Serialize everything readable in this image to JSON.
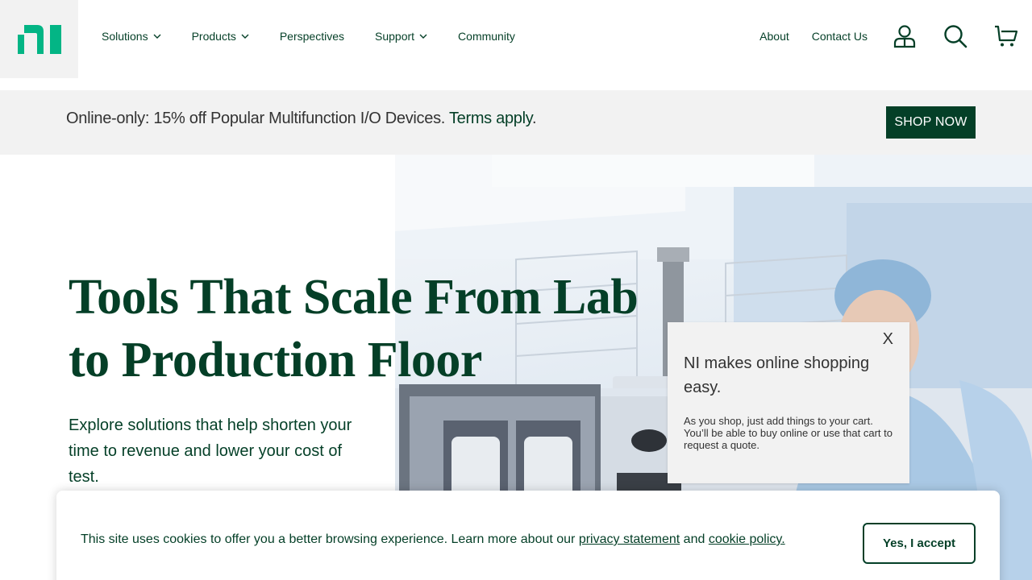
{
  "brand": {
    "logo_text": "ni",
    "accent": "#03b585",
    "dark_green": "#043f27"
  },
  "nav": {
    "items": [
      {
        "label": "Solutions",
        "has_dropdown": true
      },
      {
        "label": "Products",
        "has_dropdown": true
      },
      {
        "label": "Perspectives",
        "has_dropdown": false
      },
      {
        "label": "Support",
        "has_dropdown": true
      },
      {
        "label": "Community",
        "has_dropdown": false
      }
    ],
    "right_links": [
      {
        "label": "About"
      },
      {
        "label": "Contact Us"
      }
    ],
    "icons": [
      "user-icon",
      "search-icon",
      "cart-icon"
    ]
  },
  "promo": {
    "text": "Online-only: 15% off Popular Multifunction I/O Devices. ",
    "link_text": "Terms apply",
    "suffix": ".",
    "button_label": "SHOP NOW"
  },
  "hero": {
    "title": "Tools That Scale From Lab to Production Floor",
    "subtitle": "Explore solutions that help shorten your time to revenue and lower your cost of test."
  },
  "popup": {
    "close_label": "X",
    "title": "NI makes online shopping easy.",
    "body": "As you shop, just add things to your cart. You’ll be able to buy online or use that cart to request a quote."
  },
  "cookie": {
    "text_before": "This site uses cookies to offer you a better browsing experience. Learn more about our ",
    "privacy_link": "privacy statement",
    "middle": " and ",
    "cookie_link": "cookie policy.",
    "accept_label": "Yes, I accept"
  }
}
